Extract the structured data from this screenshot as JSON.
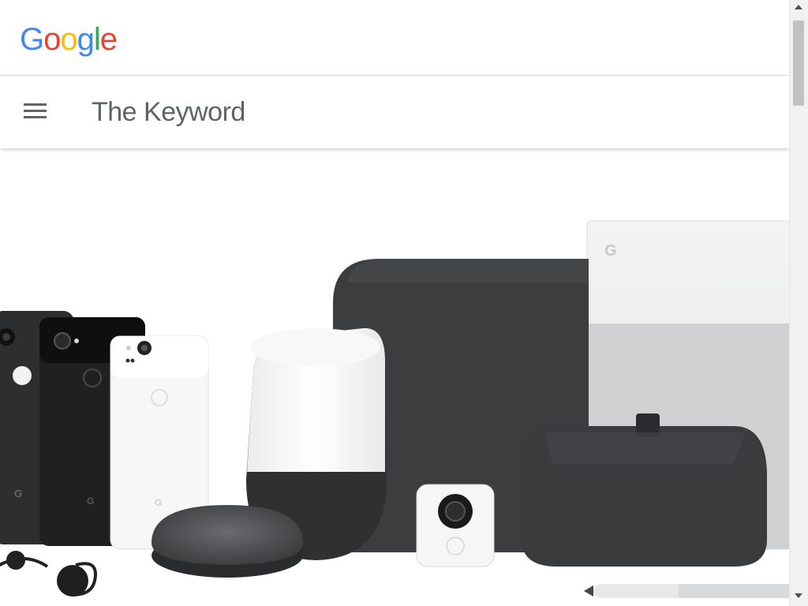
{
  "header": {
    "logo_letters": [
      {
        "char": "G",
        "color": "#4285F4"
      },
      {
        "char": "o",
        "color": "#EA4335"
      },
      {
        "char": "o",
        "color": "#FBBC05"
      },
      {
        "char": "g",
        "color": "#4285F4"
      },
      {
        "char": "l",
        "color": "#34A853"
      },
      {
        "char": "e",
        "color": "#EA4335"
      }
    ]
  },
  "nav": {
    "menu_icon": "hamburger-menu-icon",
    "site_title": "The Keyword"
  },
  "hero": {
    "image_subject": "Google hardware product lineup",
    "product_logo_letter": "G"
  },
  "colors": {
    "title_gray": "#5f6368",
    "divider": "#dadce0",
    "fabric_dark": "#3c3d3f",
    "chalk_white": "#f4f4f4"
  }
}
